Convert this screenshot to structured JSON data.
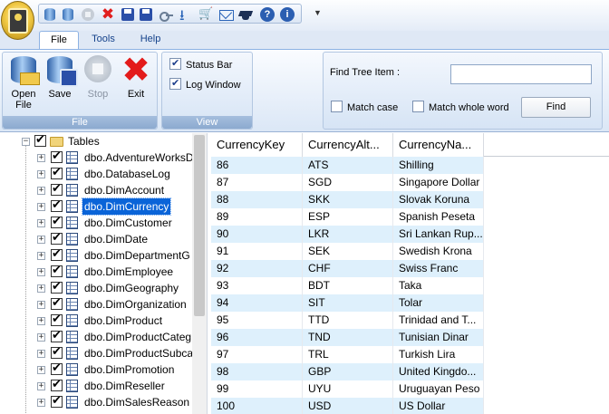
{
  "ribbon_tabs": [
    "File",
    "Tools",
    "Help"
  ],
  "file_group": {
    "label": "File",
    "buttons": [
      {
        "label1": "Open",
        "label2": "File"
      },
      {
        "label1": "Save",
        "label2": ""
      },
      {
        "label1": "Stop",
        "label2": ""
      },
      {
        "label1": "Exit",
        "label2": ""
      }
    ]
  },
  "view_group": {
    "label": "View",
    "status_bar": "Status Bar",
    "log_window": "Log Window"
  },
  "find_group": {
    "label": "Find Tree Item :",
    "input_value": "",
    "match_case": "Match case",
    "match_whole_word": "Match whole word",
    "find_button": "Find"
  },
  "tree": {
    "root": "Tables",
    "items": [
      "dbo.AdventureWorksD",
      "dbo.DatabaseLog",
      "dbo.DimAccount",
      "dbo.DimCurrency",
      "dbo.DimCustomer",
      "dbo.DimDate",
      "dbo.DimDepartmentG",
      "dbo.DimEmployee",
      "dbo.DimGeography",
      "dbo.DimOrganization",
      "dbo.DimProduct",
      "dbo.DimProductCateg",
      "dbo.DimProductSubca",
      "dbo.DimPromotion",
      "dbo.DimReseller",
      "dbo.DimSalesReason"
    ],
    "selected": "dbo.DimCurrency"
  },
  "grid": {
    "columns": [
      "CurrencyKey",
      "CurrencyAlt...",
      "CurrencyNa..."
    ],
    "rows": [
      [
        "86",
        "ATS",
        "Shilling"
      ],
      [
        "87",
        "SGD",
        "Singapore Dollar"
      ],
      [
        "88",
        "SKK",
        "Slovak Koruna"
      ],
      [
        "89",
        "ESP",
        "Spanish Peseta"
      ],
      [
        "90",
        "LKR",
        "Sri Lankan Rup..."
      ],
      [
        "91",
        "SEK",
        "Swedish Krona"
      ],
      [
        "92",
        "CHF",
        "Swiss Franc"
      ],
      [
        "93",
        "BDT",
        "Taka"
      ],
      [
        "94",
        "SIT",
        "Tolar"
      ],
      [
        "95",
        "TTD",
        "Trinidad and T..."
      ],
      [
        "96",
        "TND",
        "Tunisian Dinar"
      ],
      [
        "97",
        "TRL",
        "Turkish Lira"
      ],
      [
        "98",
        "GBP",
        "United Kingdo..."
      ],
      [
        "99",
        "UYU",
        "Uruguayan Peso"
      ],
      [
        "100",
        "USD",
        "US Dollar"
      ]
    ]
  }
}
